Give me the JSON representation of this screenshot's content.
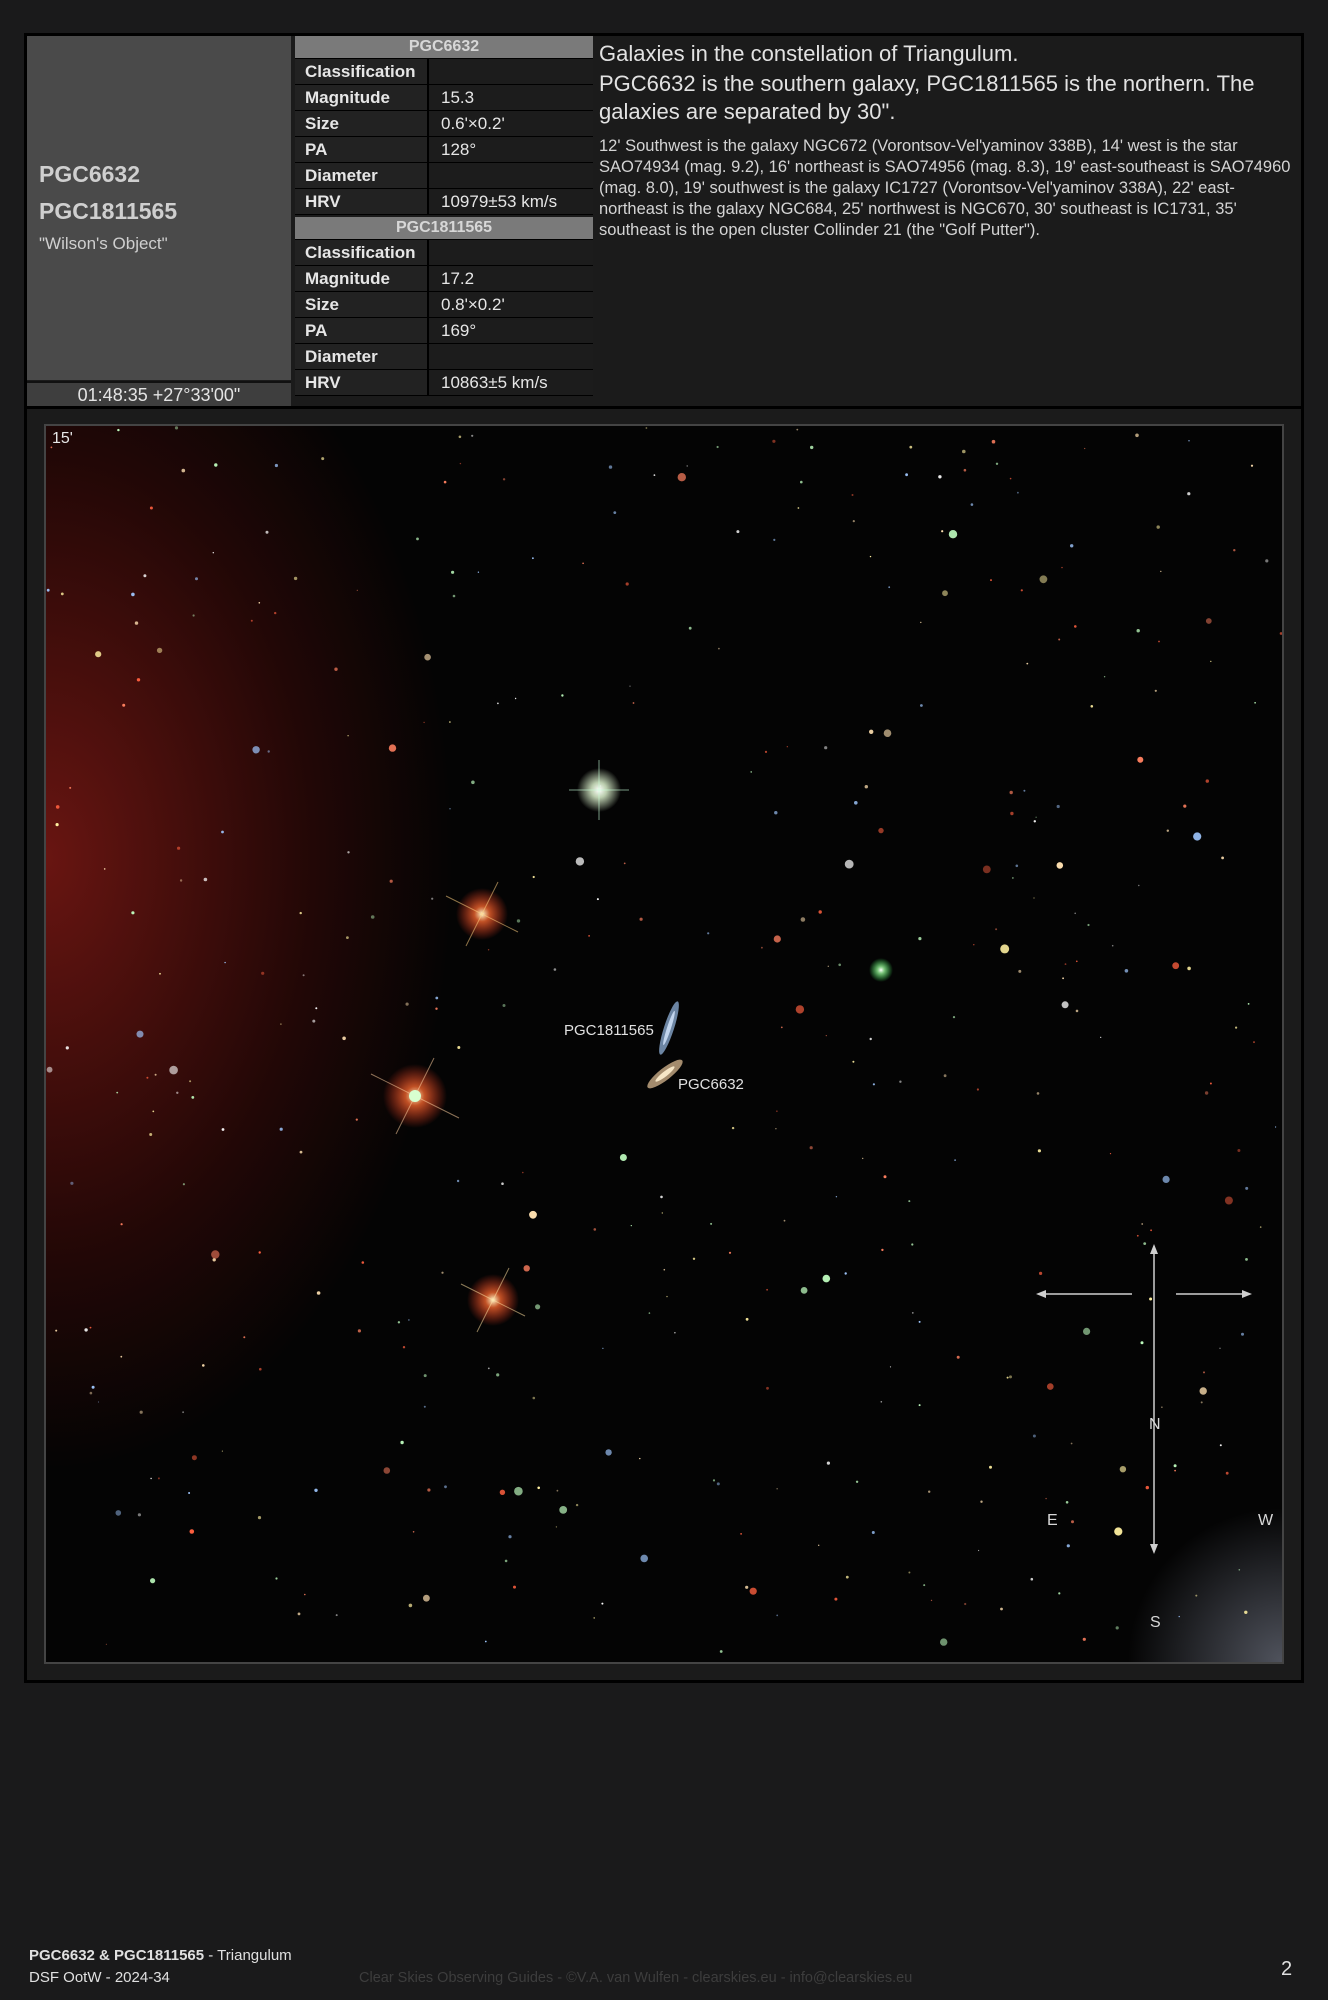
{
  "object": {
    "name1": "PGC6632",
    "name2": "PGC1811565",
    "nickname": "\"Wilson's Object\"",
    "coordinates": "01:48:35 +27°33'00\""
  },
  "table1": {
    "header": "PGC6632",
    "rows": [
      {
        "key": "Classification",
        "value": ""
      },
      {
        "key": "Magnitude",
        "value": "15.3"
      },
      {
        "key": "Size",
        "value": "0.6'×0.2'"
      },
      {
        "key": "PA",
        "value": "128°"
      },
      {
        "key": "Diameter",
        "value": ""
      },
      {
        "key": "HRV",
        "value": "10979±53 km/s"
      }
    ]
  },
  "table2": {
    "header": "PGC1811565",
    "rows": [
      {
        "key": "Classification",
        "value": ""
      },
      {
        "key": "Magnitude",
        "value": "17.2"
      },
      {
        "key": "Size",
        "value": "0.8'×0.2'"
      },
      {
        "key": "PA",
        "value": "169°"
      },
      {
        "key": "Diameter",
        "value": ""
      },
      {
        "key": "HRV",
        "value": "10863±5 km/s"
      }
    ]
  },
  "description": {
    "line1": "Galaxies in the constellation of Triangulum.",
    "line2": "PGC6632 is the southern galaxy, PGC1811565 is the northern. The galaxies are separated by 30\".",
    "body": "12' Southwest is the galaxy NGC672 (Vorontsov-Vel'yaminov 338B), 14' west is the star SAO74934 (mag. 9.2), 16' northeast is SAO74956 (mag. 8.3), 19' east-southeast is SAO74960 (mag. 8.0), 19' southwest is the galaxy IC1727 (Vorontsov-Vel'yaminov 338A), 22' east-northeast is the galaxy NGC684, 25' northwest is NGC670, 30' southeast is IC1731, 35' southeast is the open cluster Collinder 21 (the \"Golf Putter\")."
  },
  "image": {
    "scale_label": "15'",
    "label_north_galaxy": "PGC1811565",
    "label_south_galaxy": "PGC6632",
    "compass": {
      "n": "N",
      "s": "S",
      "e": "E",
      "w": "W"
    }
  },
  "footer": {
    "title_bold": "PGC6632 & PGC1811565",
    "title_rest": " - Triangulum",
    "series": "DSF OotW - 2024-34",
    "credits": "Clear Skies Observing Guides - ©V.A. van Wulfen - clearskies.eu - info@clearskies.eu",
    "page": "2"
  }
}
